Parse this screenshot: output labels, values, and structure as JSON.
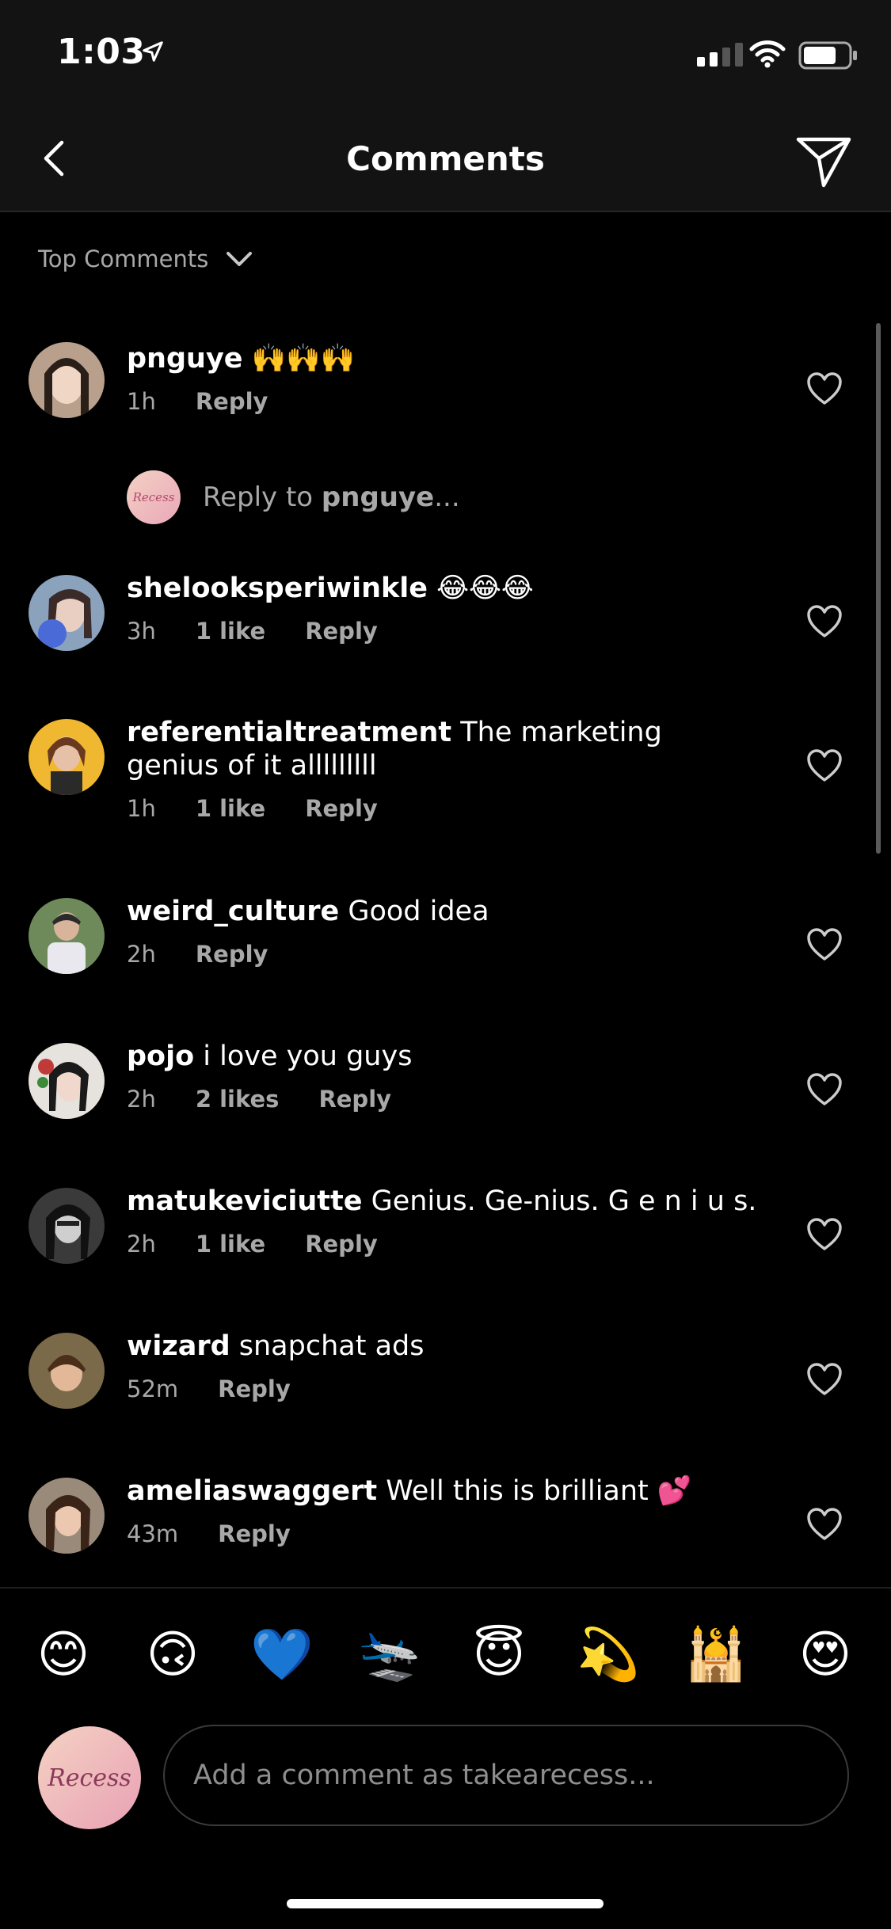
{
  "status": {
    "time": "1:03"
  },
  "nav": {
    "title": "Comments"
  },
  "sort": {
    "label": "Top Comments"
  },
  "comments": [
    {
      "user": "pnguye",
      "text": " 🙌🙌🙌",
      "time": "1h",
      "likes": "",
      "reply": "Reply"
    },
    {
      "user": "shelooksperiwinkle",
      "text": " 😂😂😂",
      "time": "3h",
      "likes": "1 like",
      "reply": "Reply"
    },
    {
      "user": "referentialtreatment",
      "text": " The marketing genius of it alllllllll",
      "time": "1h",
      "likes": "1 like",
      "reply": "Reply"
    },
    {
      "user": "weird_culture",
      "text": " Good idea",
      "time": "2h",
      "likes": "",
      "reply": "Reply"
    },
    {
      "user": "pojo",
      "text": " i love you guys",
      "time": "2h",
      "likes": "2 likes",
      "reply": "Reply"
    },
    {
      "user": "matukeviciutte",
      "text": " Genius. Ge-nius. G e n i u s.",
      "time": "2h",
      "likes": "1 like",
      "reply": "Reply"
    },
    {
      "user": "wizard",
      "text": " snapchat ads",
      "time": "52m",
      "likes": "",
      "reply": "Reply"
    },
    {
      "user": "ameliaswaggert",
      "text": " Well this is brilliant 💕",
      "time": "43m",
      "likes": "",
      "reply": "Reply"
    }
  ],
  "reply_prompt": {
    "prefix": "Reply to ",
    "user": "pnguye",
    "suffix": "..."
  },
  "mini_avatar_text": "Recess",
  "emojis": [
    "😊",
    "🙃",
    "💙",
    "🛬",
    "😇",
    "💫",
    "🕌",
    "😍"
  ],
  "compose": {
    "avatar_text": "Recess",
    "placeholder": "Add a comment as takearecess..."
  },
  "colors": {
    "background": "#000000",
    "secondary_text": "#a8a8a8",
    "bar": "#131313"
  }
}
